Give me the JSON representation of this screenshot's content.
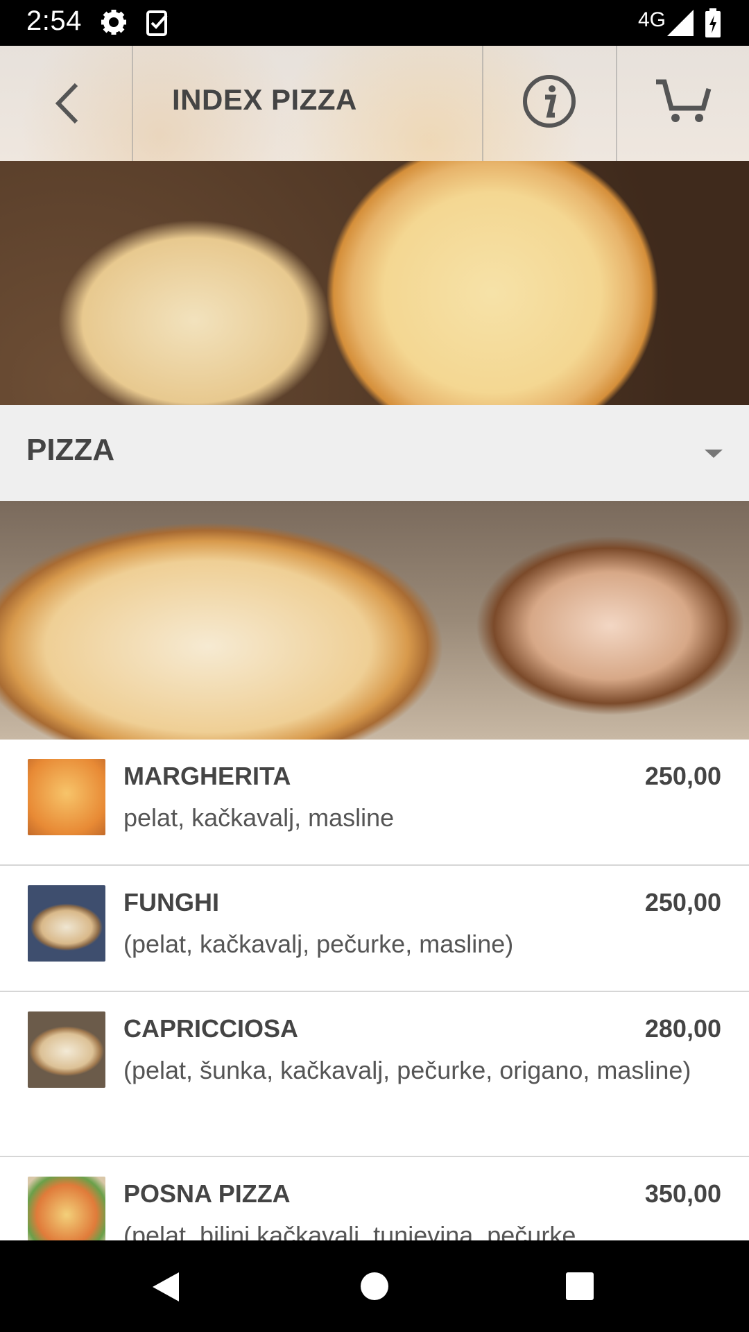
{
  "status_bar": {
    "time": "2:54",
    "network": "4G",
    "icons": [
      "gear-icon",
      "clipboard-check-icon",
      "signal-icon",
      "battery-charging-icon"
    ]
  },
  "header": {
    "title": "INDEX PIZZA",
    "icons": [
      "back-arrow-icon",
      "info-icon",
      "cart-icon"
    ]
  },
  "category": {
    "label": "PIZZA",
    "icon": "dropdown-arrow-icon"
  },
  "items": [
    {
      "name": "MARGHERITA",
      "price": "250,00",
      "description": "pelat, kačkavalj, masline"
    },
    {
      "name": "FUNGHI",
      "price": "250,00",
      "description": "(pelat, kačkavalj, pečurke, masline)"
    },
    {
      "name": "CAPRICCIOSA",
      "price": "280,00",
      "description": "(pelat, šunka, kačkavalj, pečurke, origano, masline)"
    },
    {
      "name": "POSNA PIZZA",
      "price": "350,00",
      "description": "(pelat, biljni kačkavalj, tunjevina, pečurke"
    }
  ],
  "colors": {
    "header_text": "#444444",
    "category_bg": "#efefef",
    "divider": "#d6d6d6"
  }
}
